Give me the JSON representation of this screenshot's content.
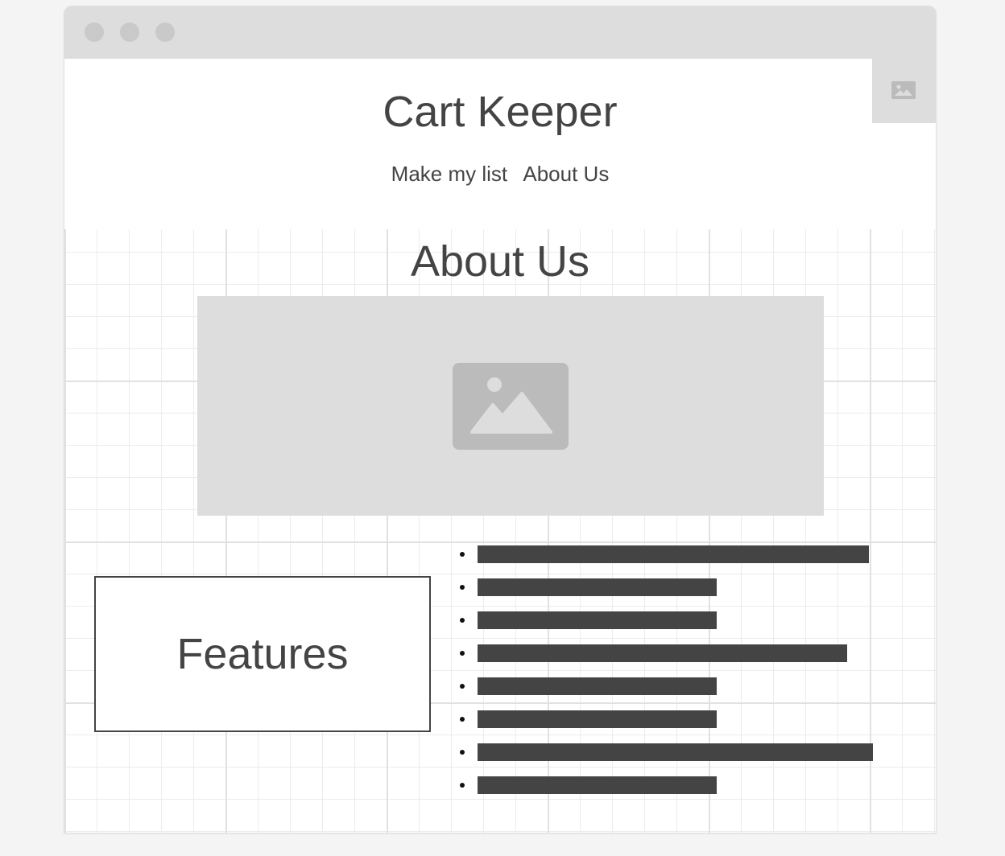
{
  "window": {
    "controls": [
      "close-dot",
      "minimize-dot",
      "maximize-dot"
    ],
    "corner_icon": "image-placeholder-icon"
  },
  "header": {
    "title": "Cart Keeper",
    "nav": [
      {
        "label": "Make my list"
      },
      {
        "label": "About Us"
      }
    ]
  },
  "main": {
    "section_title": "About Us",
    "hero_icon": "image-placeholder-icon",
    "features_label": "Features",
    "feature_items": [
      {
        "length": 0.9
      },
      {
        "length": 0.55
      },
      {
        "length": 0.55
      },
      {
        "length": 0.85
      },
      {
        "length": 0.55
      },
      {
        "length": 0.55
      },
      {
        "length": 0.91
      },
      {
        "length": 0.55
      }
    ]
  },
  "colors": {
    "text": "#444444",
    "titlebar": "#dddddd",
    "placeholder": "#dddddd",
    "placeholder_icon": "#bbbbbb",
    "bar": "#444444"
  }
}
